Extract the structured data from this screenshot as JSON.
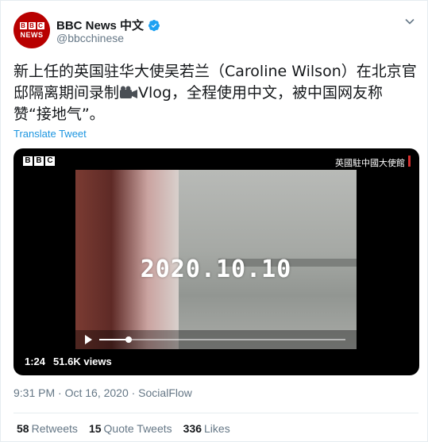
{
  "account": {
    "display_name": "BBC News 中文",
    "handle": "@bbcchinese",
    "avatar_blocks": [
      "B",
      "B",
      "C"
    ],
    "avatar_word": "NEWS",
    "verified_icon": "verified-badge-icon"
  },
  "tweet": {
    "text_before": "新上任的英国驻华大使吴若兰（Caroline Wilson）在北京官邸隔离期间录制",
    "emoji": "camera-icon",
    "text_after": "Vlog，全程使用中文，被中国网友称赞“接地气”。",
    "translate_label": "Translate Tweet"
  },
  "media": {
    "logo_blocks": [
      "B",
      "B",
      "C"
    ],
    "channel_label": "英國駐中國大使館",
    "date_overlay": "2020.10.10",
    "duration": "1:24",
    "views": "51.6K views",
    "progress": 0.12
  },
  "meta": {
    "timestamp": "9:31 PM · Oct 16, 2020 · SocialFlow"
  },
  "stats": [
    {
      "num": "58",
      "label": "Retweets"
    },
    {
      "num": "15",
      "label": "Quote Tweets"
    },
    {
      "num": "336",
      "label": "Likes"
    }
  ],
  "colors": {
    "brand_red": "#b80000",
    "link_blue": "#1b95e0",
    "muted": "#657786",
    "verified_blue": "#1da1f2"
  }
}
